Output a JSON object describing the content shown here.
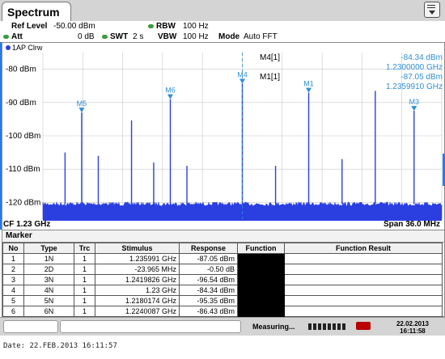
{
  "tab": {
    "title": "Spectrum"
  },
  "params": {
    "ref_level_label": "Ref Level",
    "ref_level": "-50.00 dBm",
    "att_label": "Att",
    "att": "0 dB",
    "swt_label": "SWT",
    "swt": "2 s",
    "rbw_label": "RBW",
    "rbw": "100 Hz",
    "vbw_label": "VBW",
    "vbw": "100 Hz",
    "mode_label": "Mode",
    "mode": "Auto FFT"
  },
  "trace": {
    "label": "1AP Clrw",
    "color": "#2b3fe0"
  },
  "marker_readout": {
    "m4_label": "M4[1]",
    "m4_level": "-84.34 dBm",
    "m4_freq": "1.2300000 GHz",
    "m1_label": "M1[1]",
    "m1_level": "-87.05 dBm",
    "m1_freq": "1.2359910 GHz"
  },
  "axis": {
    "cf": "CF 1.23 GHz",
    "span": "Span 36.0 MHz",
    "marker_color": "#2f8fd8"
  },
  "chart_data": {
    "type": "line",
    "yticks": [
      "-80 dBm",
      "-90 dBm",
      "-100 dBm",
      "-110 dBm",
      "-120 dBm"
    ],
    "ylim": [
      -125,
      -75
    ],
    "xlim": [
      -18,
      18
    ],
    "noise_floor": -120.5,
    "peaks": [
      {
        "x": -16.0,
        "y": -105
      },
      {
        "x": -14.5,
        "y": -93
      },
      {
        "x": -13.0,
        "y": -106
      },
      {
        "x": -10.0,
        "y": -95.35
      },
      {
        "x": -8.0,
        "y": -108
      },
      {
        "x": -6.5,
        "y": -89
      },
      {
        "x": -5.0,
        "y": -109
      },
      {
        "x": 0.0,
        "y": -84.34
      },
      {
        "x": 3.0,
        "y": -109
      },
      {
        "x": 5.99,
        "y": -87.05
      },
      {
        "x": 9.0,
        "y": -107
      },
      {
        "x": 12.0,
        "y": -86.5
      },
      {
        "x": 15.5,
        "y": -92.5
      }
    ],
    "markers": [
      {
        "label": "M5",
        "x": -14.5,
        "y": -93
      },
      {
        "label": "M6",
        "x": -6.5,
        "y": -89
      },
      {
        "label": "M4",
        "x": 0.0,
        "y": -84.34
      },
      {
        "label": "M1",
        "x": 5.99,
        "y": -87.05
      },
      {
        "label": "M3",
        "x": 15.5,
        "y": -92.5
      }
    ]
  },
  "marker_table": {
    "title": "Marker",
    "headers": [
      "No",
      "Type",
      "Trc",
      "Stimulus",
      "Response",
      "Function",
      "Function Result"
    ],
    "rows": [
      [
        "1",
        "1N",
        "1",
        "1.235991 GHz",
        "-87.05 dBm"
      ],
      [
        "2",
        "2D",
        "1",
        "-23.965 MHz",
        "-0.50 dB"
      ],
      [
        "3",
        "3N",
        "1",
        "1.2419826 GHz",
        "-96.54 dBm"
      ],
      [
        "4",
        "4N",
        "1",
        "1.23 GHz",
        "-84.34 dBm"
      ],
      [
        "5",
        "5N",
        "1",
        "1.2180174 GHz",
        "-95.35 dBm"
      ],
      [
        "6",
        "6N",
        "1",
        "1.2240087 GHz",
        "-86.43 dBm"
      ]
    ]
  },
  "status": {
    "measuring": "Measuring...",
    "date": "22.02.2013",
    "time": "16:11:58"
  },
  "footer": {
    "text": "Date: 22.FEB.2013  16:11:57"
  }
}
